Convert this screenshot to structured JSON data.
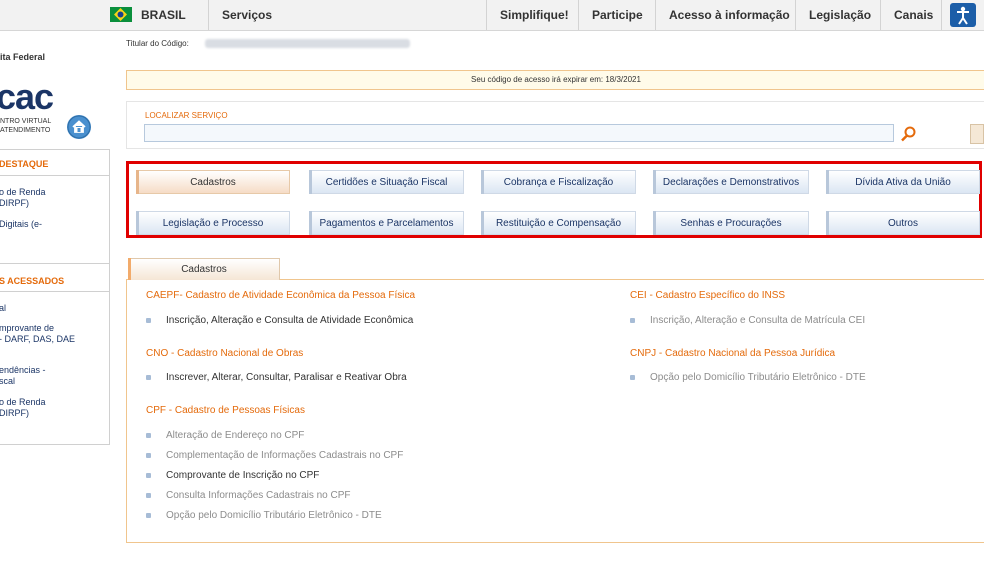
{
  "govbar": {
    "country": "BRASIL",
    "items": [
      "Serviços",
      "Simplifique!",
      "Participe",
      "Acesso à informação",
      "Legislação",
      "Canais"
    ]
  },
  "sidebar": {
    "org": "ita Federal",
    "logo": "cac",
    "logo_sub": [
      "NTRO VIRTUAL",
      "ATENDIMENTO"
    ],
    "destaque_title": "DESTAQUE",
    "destaque_links": [
      [
        "o de Renda",
        "DIRPF)"
      ],
      [
        "Digitais (e-"
      ]
    ],
    "acessados_title": "S ACESSADOS",
    "acessados_links": [
      [
        "al"
      ],
      [
        "mprovante de",
        "- DARF, DAS, DAE"
      ],
      [
        "endências -",
        "scal"
      ],
      [
        "o de Renda",
        "DIRPF)"
      ]
    ]
  },
  "header": {
    "titular_label": "Titular do Código:",
    "notice": "Seu código de acesso irá expirar em: 18/3/2021",
    "search_label": "LOCALIZAR SERVIÇO",
    "search_value": ""
  },
  "categories": [
    [
      "Cadastros",
      "Certidões e Situação Fiscal",
      "Cobrança e Fiscalização",
      "Declarações e Demonstrativos",
      "Dívida Ativa da União"
    ],
    [
      "Legislação e Processo",
      "Pagamentos e Parcelamentos",
      "Restituição e Compensação",
      "Senhas e Procurações",
      "Outros"
    ]
  ],
  "active_category": "Cadastros",
  "content": {
    "tab": "Cadastros",
    "left": [
      {
        "title": "CAEPF- Cadastro de Atividade Econômica da Pessoa Física",
        "links": [
          {
            "text": "Inscrição, Alteração e Consulta de Atividade Econômica",
            "enabled": true
          }
        ]
      },
      {
        "title": "CNO - Cadastro Nacional de Obras",
        "links": [
          {
            "text": "Inscrever, Alterar, Consultar, Paralisar e Reativar Obra",
            "enabled": true
          }
        ]
      },
      {
        "title": "CPF - Cadastro de Pessoas Físicas",
        "links": [
          {
            "text": "Alteração de Endereço no CPF",
            "enabled": false
          },
          {
            "text": "Complementação de Informações Cadastrais no CPF",
            "enabled": false
          },
          {
            "text": "Comprovante de Inscrição no CPF",
            "enabled": true
          },
          {
            "text": "Consulta Informações Cadastrais no CPF",
            "enabled": false
          },
          {
            "text": "Opção pelo Domicílio Tributário Eletrônico - DTE",
            "enabled": false
          }
        ]
      }
    ],
    "right": [
      {
        "title": "CEI - Cadastro Específico do INSS",
        "links": [
          {
            "text": "Inscrição, Alteração e Consulta de Matrícula CEI",
            "enabled": false
          }
        ]
      },
      {
        "title": "CNPJ - Cadastro Nacional da Pessoa Jurídica",
        "links": [
          {
            "text": "Opção pelo Domicílio Tributário Eletrônico - DTE",
            "enabled": false
          }
        ]
      }
    ]
  },
  "colors": {
    "accent": "#e46a0b",
    "brand": "#1b3566",
    "highlight_frame": "#e00000"
  }
}
